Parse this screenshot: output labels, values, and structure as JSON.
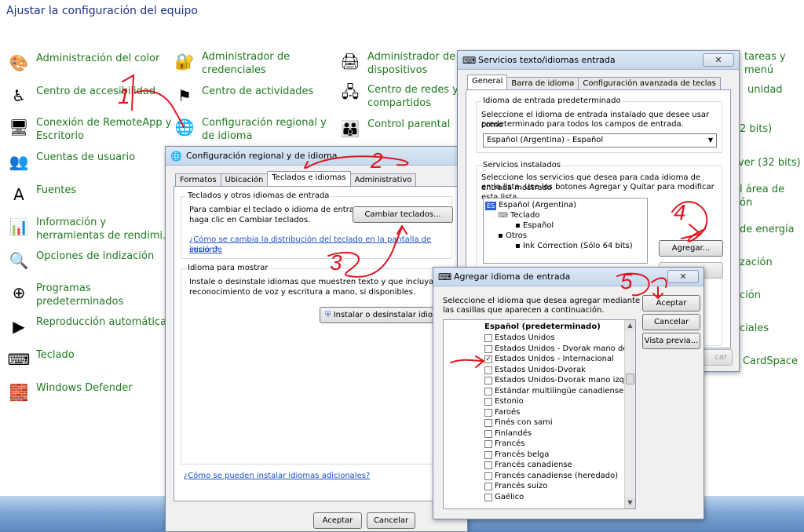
{
  "control_panel": {
    "title": "Ajustar la configuración del equipo",
    "items": [
      {
        "icon": "color-management-icon",
        "lines": [
          "Administración del color"
        ]
      },
      {
        "icon": "accessibility-icon",
        "lines": [
          "Centro de accesibilidad"
        ]
      },
      {
        "icon": "remoteapp-icon",
        "lines": [
          "Conexión de RemoteApp y",
          "Escritorio"
        ]
      },
      {
        "icon": "user-accounts-icon",
        "lines": [
          "Cuentas de usuario"
        ]
      },
      {
        "icon": "fonts-icon",
        "lines": [
          "Fuentes"
        ]
      },
      {
        "icon": "performance-icon",
        "lines": [
          "Información y",
          "herramientas de rendimi..."
        ]
      },
      {
        "icon": "indexing-icon",
        "lines": [
          "Opciones de indización"
        ]
      },
      {
        "icon": "default-programs-icon",
        "lines": [
          "Programas",
          "predeterminados"
        ]
      },
      {
        "icon": "autoplay-icon",
        "lines": [
          "Reproducción automática"
        ]
      },
      {
        "icon": "keyboard-icon",
        "lines": [
          "Teclado"
        ]
      },
      {
        "icon": "defender-icon",
        "lines": [
          "Windows Defender"
        ]
      },
      {
        "icon": "credentials-icon",
        "lines": [
          "Administrador de",
          "credenciales"
        ]
      },
      {
        "icon": "action-center-icon",
        "lines": [
          "Centro de actividades"
        ]
      },
      {
        "icon": "region-language-icon",
        "lines": [
          "Configuración regional y",
          "de idioma"
        ]
      },
      {
        "icon": "device-manager-icon",
        "lines": [
          "Administrador de",
          "dispositivos"
        ]
      },
      {
        "icon": "network-center-icon",
        "lines": [
          "Centro de redes y r",
          "compartidos"
        ]
      },
      {
        "icon": "parental-control-icon",
        "lines": [
          "Control parental"
        ]
      }
    ],
    "right_fragments": [
      "tareas y menú",
      "unidad",
      "2 bits)",
      "ver (32 bits)",
      "l área de",
      "ón",
      "de energía",
      "zación",
      "ción",
      "ciales",
      "CardSpace"
    ]
  },
  "regional_dialog": {
    "title": "Configuración regional y de idioma",
    "tabs": [
      "Formatos",
      "Ubicación",
      "Teclados e idiomas",
      "Administrativo"
    ],
    "group1_title": "Teclados y otros idiomas de entrada",
    "group1_text_1": "Para cambiar el teclado o idioma de entrada,",
    "group1_text_2": "haga clic en Cambiar teclados.",
    "change_keyboards_button": "Cambiar teclados...",
    "help_link_1": "¿Cómo se cambia la distribución del teclado en la pantalla de inicio de",
    "help_link_2": "sesión?",
    "group2_title": "Idioma para mostrar",
    "group2_text_1": "Instale o desinstale idiomas que muestren texto y que incluyan",
    "group2_text_2": "reconocimiento de voz y escritura a mano, si disponibles.",
    "install_button": "Instalar o desinstalar idiom",
    "bottom_link": "¿Cómo se pueden instalar idiomas adicionales?",
    "ok_button": "Aceptar",
    "cancel_button": "Cancelar"
  },
  "text_services_dialog": {
    "title": "Servicios texto/idiomas entrada",
    "tabs": [
      "General",
      "Barra de idioma",
      "Configuración avanzada de teclas"
    ],
    "default_group_title": "Idioma de entrada predeterminado",
    "default_text_1": "Seleccione el idioma de entrada instalado que desee usar como",
    "default_text_2": "predeterminado para todos los campos de entrada.",
    "default_select": "Español (Argentina) - Español",
    "installed_group_title": "Servicios instalados",
    "installed_text_1": "Seleccione los servicios que desea para cada idioma de entrada mostrado",
    "installed_text_2": "en la lista. Use los botones Agregar y Quitar para modificar esta lista.",
    "lang_badge": "ES",
    "tree": [
      "Español (Argentina)",
      "Teclado",
      "Español",
      "Otros",
      "Ink Correction (Sólo 64 bits)"
    ],
    "add_button": "Agregar...",
    "remove_button": "Quitar",
    "apply_fragment": "car"
  },
  "add_language_dialog": {
    "title": "Agregar idioma de entrada",
    "instruction_1": "Seleccione el idioma que desea agregar mediante el uso de",
    "instruction_2": "las casillas que aparecen a continuación.",
    "ok_button": "Aceptar",
    "cancel_button": "Cancelar",
    "preview_button": "Vista previa...",
    "list_header": "Español (predeterminado)",
    "languages": [
      {
        "label": "Estados Unidos",
        "checked": false
      },
      {
        "label": "Estados Unidos - Dvorak mano derecha",
        "checked": false
      },
      {
        "label": "Estados Unidos - Internacional",
        "checked": true
      },
      {
        "label": "Estados Unidos-Dvorak",
        "checked": false
      },
      {
        "label": "Estados Unidos-Dvorak mano izquierda",
        "checked": false
      },
      {
        "label": "Estándar multilingüe canadiense",
        "checked": false
      },
      {
        "label": "Estonio",
        "checked": false
      },
      {
        "label": "Faroés",
        "checked": false
      },
      {
        "label": "Finés con sami",
        "checked": false
      },
      {
        "label": "Finlandés",
        "checked": false
      },
      {
        "label": "Francés",
        "checked": false
      },
      {
        "label": "Francés belga",
        "checked": false
      },
      {
        "label": "Francés canadiense",
        "checked": false
      },
      {
        "label": "Francés canadiense (heredado)",
        "checked": false
      },
      {
        "label": "Francés suizo",
        "checked": false
      },
      {
        "label": "Gaélico",
        "checked": false
      }
    ]
  },
  "annotations": [
    "1",
    "2",
    "3",
    "4",
    "5"
  ],
  "colors": {
    "link_green": "#1f7a1f",
    "title_blue": "#1e3287",
    "annotation_red": "#e0141e",
    "hyperlink_blue": "#1a4fc4"
  }
}
